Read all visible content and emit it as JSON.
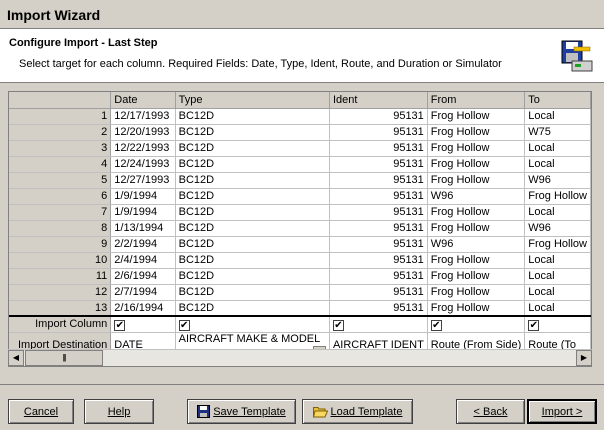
{
  "window": {
    "title": "Import Wizard"
  },
  "header": {
    "title": "Configure Import - Last Step",
    "subtitle": "Select target for each column. Required Fields: Date, Type, Ident, Route, and Duration or Simulator"
  },
  "grid": {
    "columns": [
      "Date",
      "Type",
      "Ident",
      "From",
      "To"
    ],
    "rows": [
      {
        "n": "1",
        "date": "12/17/1993",
        "type": "BC12D",
        "ident": "95131",
        "from": "Frog Hollow",
        "to": "Local"
      },
      {
        "n": "2",
        "date": "12/20/1993",
        "type": "BC12D",
        "ident": "95131",
        "from": "Frog Hollow",
        "to": "W75"
      },
      {
        "n": "3",
        "date": "12/22/1993",
        "type": "BC12D",
        "ident": "95131",
        "from": "Frog Hollow",
        "to": "Local"
      },
      {
        "n": "4",
        "date": "12/24/1993",
        "type": "BC12D",
        "ident": "95131",
        "from": "Frog Hollow",
        "to": "Local"
      },
      {
        "n": "5",
        "date": "12/27/1993",
        "type": "BC12D",
        "ident": "95131",
        "from": "Frog Hollow",
        "to": "W96"
      },
      {
        "n": "6",
        "date": "1/9/1994",
        "type": "BC12D",
        "ident": "95131",
        "from": "W96",
        "to": "Frog Hollow"
      },
      {
        "n": "7",
        "date": "1/9/1994",
        "type": "BC12D",
        "ident": "95131",
        "from": "Frog Hollow",
        "to": "Local"
      },
      {
        "n": "8",
        "date": "1/13/1994",
        "type": "BC12D",
        "ident": "95131",
        "from": "Frog Hollow",
        "to": "W96"
      },
      {
        "n": "9",
        "date": "2/2/1994",
        "type": "BC12D",
        "ident": "95131",
        "from": "W96",
        "to": "Frog Hollow"
      },
      {
        "n": "10",
        "date": "2/4/1994",
        "type": "BC12D",
        "ident": "95131",
        "from": "Frog Hollow",
        "to": "Local"
      },
      {
        "n": "11",
        "date": "2/6/1994",
        "type": "BC12D",
        "ident": "95131",
        "from": "Frog Hollow",
        "to": "Local"
      },
      {
        "n": "12",
        "date": "2/7/1994",
        "type": "BC12D",
        "ident": "95131",
        "from": "Frog Hollow",
        "to": "Local"
      },
      {
        "n": "13",
        "date": "2/16/1994",
        "type": "BC12D",
        "ident": "95131",
        "from": "Frog Hollow",
        "to": "Local"
      }
    ],
    "import_column_label": "Import Column",
    "import_destination_label": "Import Destination",
    "import_checked": [
      "✔",
      "✔",
      "✔",
      "✔",
      "✔"
    ],
    "destinations": [
      "DATE",
      "AIRCRAFT MAKE & MODEL",
      "AIRCRAFT IDENT",
      "Route (From Side)",
      "Route (To"
    ]
  },
  "buttons": {
    "cancel": "Cancel",
    "help": "Help",
    "save_template": "Save Template",
    "load_template": "Load Template",
    "back": "< Back",
    "import": "Import >"
  }
}
